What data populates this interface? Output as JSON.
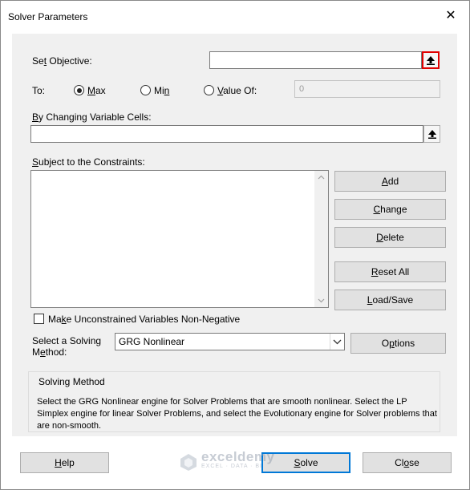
{
  "window": {
    "title": "Solver Parameters"
  },
  "objective": {
    "label": "Set Objective:",
    "label_u": "t",
    "value": ""
  },
  "to": {
    "label": "To:",
    "options": [
      {
        "label": "Max",
        "u": "M",
        "selected": true
      },
      {
        "label": "Min",
        "u": "n",
        "selected": false
      },
      {
        "label": "Value Of:",
        "u": "V",
        "selected": false
      }
    ],
    "value_of": "0"
  },
  "changing": {
    "label": "By Changing Variable Cells:",
    "u": "B",
    "value": ""
  },
  "constraints": {
    "label": "Subject to the Constraints:",
    "u": "u",
    "items": []
  },
  "buttons": {
    "add": "Add",
    "change": "Change",
    "delete": "Delete",
    "reset": "Reset All",
    "loadsave": "Load/Save",
    "options": "Options",
    "help": "Help",
    "solve": "Solve",
    "close": "Close"
  },
  "nonneg": {
    "label": "Make Unconstrained Variables Non-Negative",
    "checked": false
  },
  "method": {
    "label_line1": "Select a Solving",
    "label_line2": "Method:",
    "selected": "GRG Nonlinear"
  },
  "solving_method": {
    "heading": "Solving Method",
    "description": "Select the GRG Nonlinear engine for Solver Problems that are smooth nonlinear. Select the LP Simplex engine for linear Solver Problems, and select the Evolutionary engine for Solver problems that are non-smooth."
  },
  "watermark": {
    "name": "exceldemy",
    "sub": "EXCEL · DATA · BI"
  },
  "colors": {
    "highlight": "#e00000",
    "default_button_border": "#0078d7",
    "panel_bg": "#f0f0f0"
  }
}
